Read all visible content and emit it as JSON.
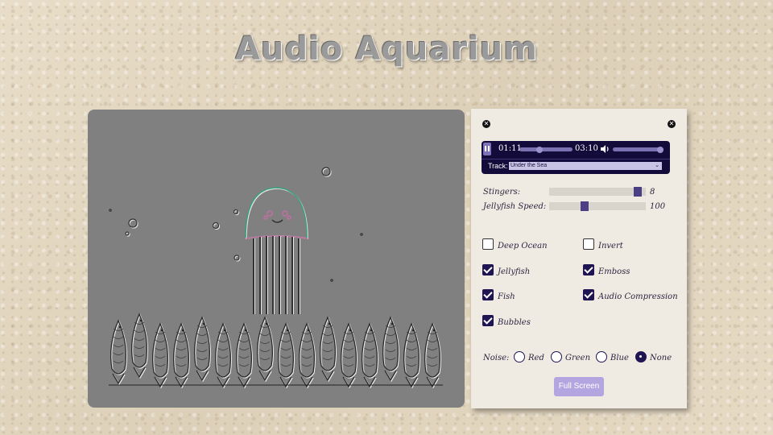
{
  "app": {
    "title": "Audio Aquarium"
  },
  "player": {
    "current_time": "01:11",
    "duration": "03:10",
    "progress": 0.37,
    "volume": 1.0,
    "track_label": "Track:",
    "track_value": "Under the Sea"
  },
  "sliders": [
    {
      "label": "Stingers:",
      "value": "8",
      "fraction": 0.95
    },
    {
      "label": "Jellyfish Speed:",
      "value": "100",
      "fraction": 0.35
    }
  ],
  "options": {
    "deep_ocean": {
      "label": "Deep Ocean",
      "checked": false
    },
    "invert": {
      "label": "Invert",
      "checked": false
    },
    "jellyfish": {
      "label": "Jellyfish",
      "checked": true
    },
    "emboss": {
      "label": "Emboss",
      "checked": true
    },
    "fish": {
      "label": "Fish",
      "checked": true
    },
    "audio_compression": {
      "label": "Audio Compression",
      "checked": true
    },
    "bubbles": {
      "label": "Bubbles",
      "checked": true
    }
  },
  "noise": {
    "label": "Noise:",
    "choices": [
      {
        "label": "Red",
        "selected": false
      },
      {
        "label": "Green",
        "selected": false
      },
      {
        "label": "Blue",
        "selected": false
      },
      {
        "label": "None",
        "selected": true
      }
    ]
  },
  "buttons": {
    "full_screen": "Full Screen"
  },
  "colors": {
    "accent": "#1f1552",
    "player_bg": "#130c3a",
    "canvas_bg": "#808080",
    "button": "#b3a6e0"
  },
  "icons": {
    "close": "close-icon",
    "play": "pause-icon",
    "volume": "volume-icon",
    "dropdown": "chevron-down-icon"
  }
}
